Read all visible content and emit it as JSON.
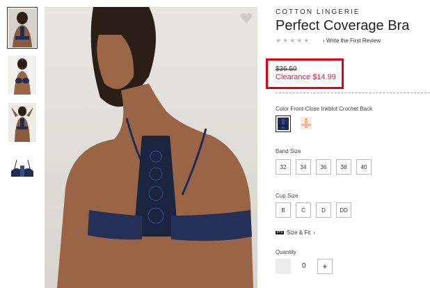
{
  "product": {
    "subtitle": "COTTON LINGERIE",
    "title": "Perfect Coverage Bra",
    "stars": "★★★★★",
    "review_link": "Write the First Review",
    "was_price": "$36.50",
    "sale_price": "Clearance $14.99"
  },
  "color": {
    "label": "Color Front-Close Inkblot Crochet Back",
    "swatches": [
      "#1f2d52",
      "#e9b79c"
    ],
    "selected_index": 0
  },
  "band": {
    "label": "Band Size",
    "options": [
      "32",
      "34",
      "36",
      "38",
      "40"
    ]
  },
  "cup": {
    "label": "Cup Size",
    "options": [
      "B",
      "C",
      "D",
      "DD"
    ]
  },
  "fit_link": "Size & Fit",
  "quantity": {
    "label": "Quantity",
    "value": "0",
    "plus": "+"
  },
  "colors": {
    "sale_accent": "#d9184f",
    "highlight_border": "#e10014",
    "navy": "#1f2d52"
  }
}
